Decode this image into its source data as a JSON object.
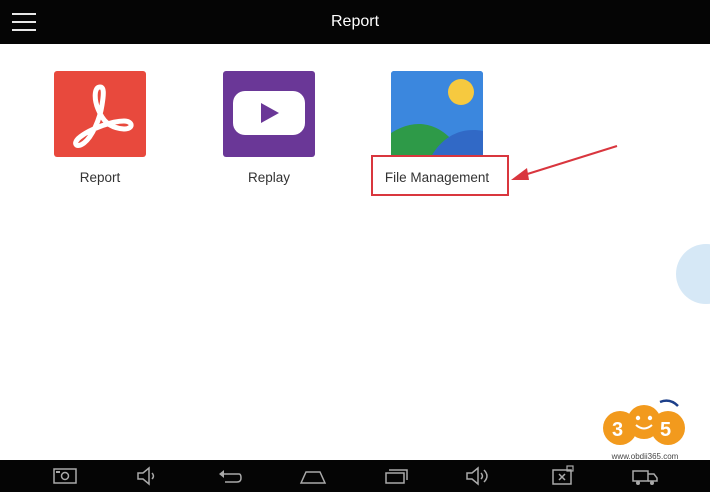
{
  "header": {
    "title": "Report"
  },
  "tiles": [
    {
      "label": "Report",
      "icon": "pdf-icon",
      "color": "#e8493d"
    },
    {
      "label": "Replay",
      "icon": "play-icon",
      "color": "#6a3797"
    },
    {
      "label": "File Management",
      "icon": "gallery-icon",
      "color": "#3a86dd"
    }
  ],
  "watermark": {
    "text": "www.obdii365.com",
    "logo": "365"
  },
  "navbar": {
    "items": [
      "screenshot-icon",
      "volume-down-icon",
      "back-icon",
      "home-icon",
      "recents-icon",
      "volume-up-icon",
      "vci-icon",
      "truck-icon"
    ]
  },
  "colors": {
    "annotation": "#d9363e",
    "bar": "#050505"
  }
}
